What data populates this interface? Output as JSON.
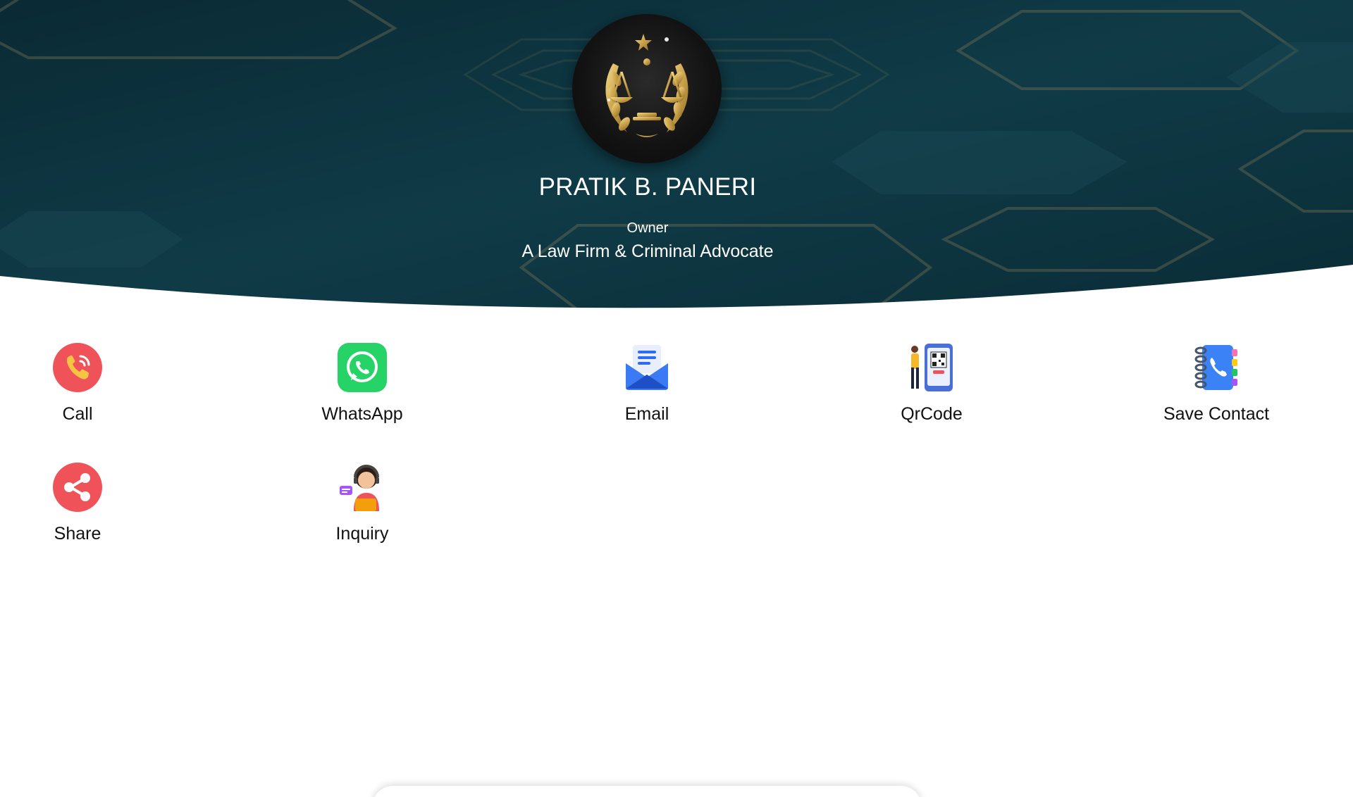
{
  "profile": {
    "name": "PRATIK B. PANERI",
    "role": "Owner",
    "firm": "A Law Firm & Criminal Advocate",
    "logo_icon": "scales-of-justice-icon"
  },
  "colors": {
    "banner_dark": "#0b2b36",
    "banner_teal": "#124652",
    "accent_gold": "#c9a24a",
    "call_red": "#f0525a",
    "whatsapp_green": "#25d366",
    "email_blue": "#2f6bf0"
  },
  "actions": [
    {
      "label": "Call",
      "icon": "phone-call-icon"
    },
    {
      "label": "WhatsApp",
      "icon": "whatsapp-icon"
    },
    {
      "label": "Email",
      "icon": "email-envelope-icon"
    },
    {
      "label": "QrCode",
      "icon": "qr-code-phone-icon"
    },
    {
      "label": "Save Contact",
      "icon": "address-book-icon"
    },
    {
      "label": "Share",
      "icon": "share-icon"
    },
    {
      "label": "Inquiry",
      "icon": "support-agent-icon"
    }
  ]
}
